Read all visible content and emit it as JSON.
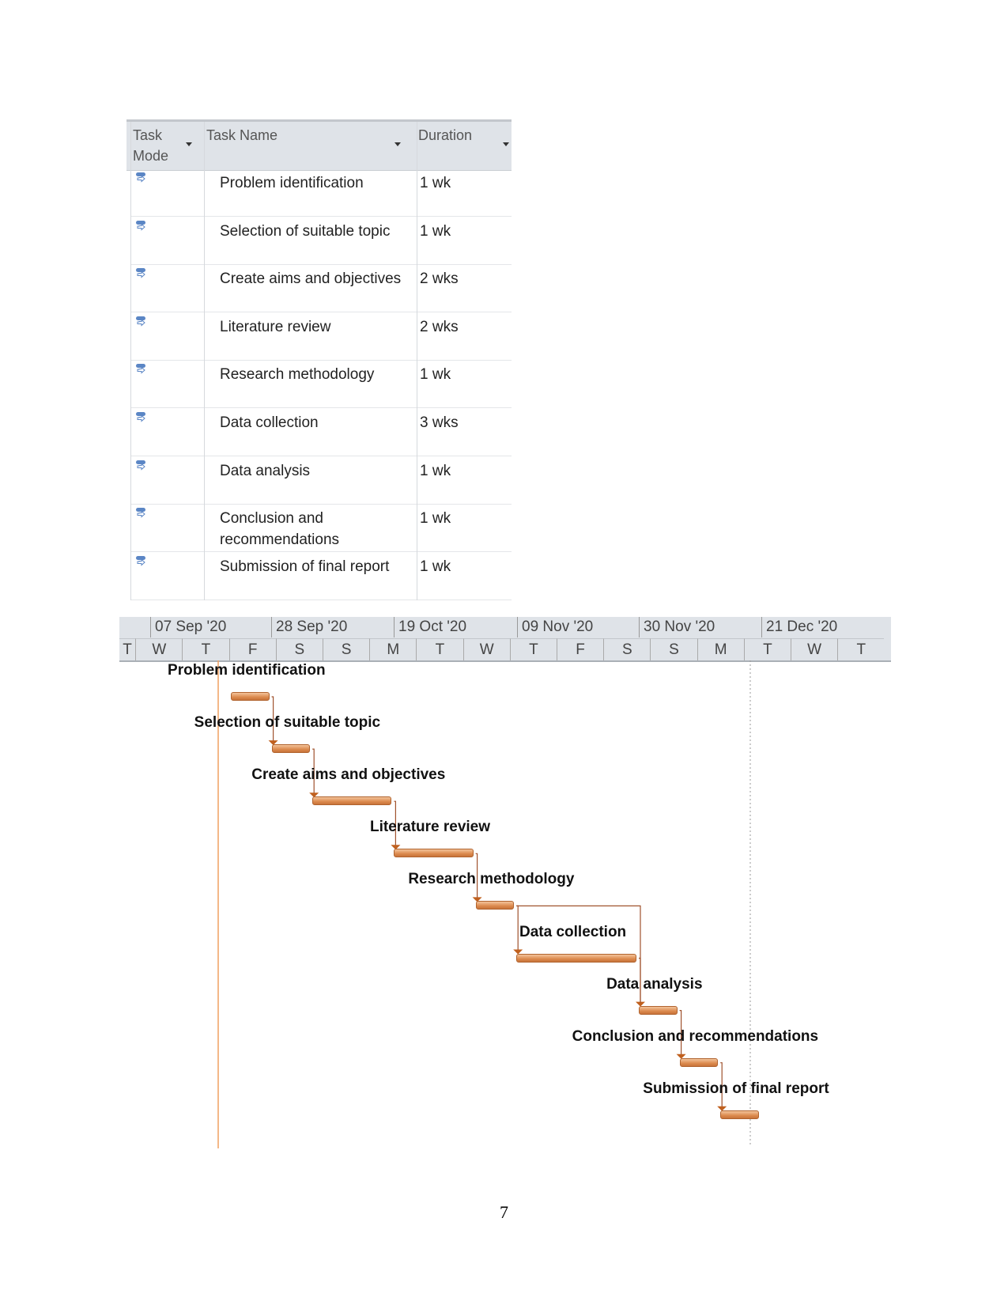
{
  "table": {
    "headers": {
      "mode": "Task\nMode",
      "mode_line1": "Task",
      "mode_line2": "Mode",
      "name": "Task Name",
      "duration": "Duration"
    },
    "rows": [
      {
        "name": "Problem identification",
        "duration": "1 wk",
        "mode_icon": "auto-scheduled-task-icon"
      },
      {
        "name": "Selection of suitable topic",
        "duration": "1 wk",
        "mode_icon": "auto-scheduled-task-icon"
      },
      {
        "name": "Create aims and objectives",
        "duration": "2 wks",
        "mode_icon": "auto-scheduled-task-icon"
      },
      {
        "name": "Literature review",
        "duration": "2 wks",
        "mode_icon": "auto-scheduled-task-icon"
      },
      {
        "name": "Research methodology",
        "duration": "1 wk",
        "mode_icon": "auto-scheduled-task-icon"
      },
      {
        "name": "Data collection",
        "duration": "3 wks",
        "mode_icon": "auto-scheduled-task-icon"
      },
      {
        "name": "Data analysis",
        "duration": "1 wk",
        "mode_icon": "auto-scheduled-task-icon"
      },
      {
        "name": "Conclusion and recommendations",
        "duration": "1 wk",
        "mode_icon": "auto-scheduled-task-icon"
      },
      {
        "name": "Submission of final report",
        "duration": "1 wk",
        "mode_icon": "auto-scheduled-task-icon"
      }
    ]
  },
  "timeline": {
    "months": [
      "07 Sep '20",
      "28 Sep '20",
      "19 Oct '20",
      "09 Nov '20",
      "30 Nov '20",
      "21 Dec '20"
    ],
    "days": [
      "T",
      "W",
      "T",
      "F",
      "S",
      "S",
      "M",
      "T",
      "W",
      "T",
      "F",
      "S",
      "S",
      "M",
      "T",
      "W",
      "T"
    ]
  },
  "chart_data": {
    "type": "gantt",
    "tasks": [
      {
        "name": "Problem identification",
        "duration_weeks": 1
      },
      {
        "name": "Selection of suitable topic",
        "duration_weeks": 1,
        "predecessor": 0
      },
      {
        "name": "Create aims and objectives",
        "duration_weeks": 2,
        "predecessor": 1
      },
      {
        "name": "Literature review",
        "duration_weeks": 2,
        "predecessor": 2
      },
      {
        "name": "Research methodology",
        "duration_weeks": 1,
        "predecessor": 3
      },
      {
        "name": "Data collection",
        "duration_weeks": 3,
        "predecessor": 4
      },
      {
        "name": "Data analysis",
        "duration_weeks": 1,
        "predecessor": 5
      },
      {
        "name": "Conclusion and recommendations",
        "duration_weeks": 1,
        "predecessor": 6
      },
      {
        "name": "Submission of final report",
        "duration_weeks": 1,
        "predecessor": 7
      }
    ],
    "colors": {
      "bar": "#dc8a4e",
      "link": "#a0522d",
      "today_line": "#f0a060"
    }
  },
  "page_number": "7"
}
